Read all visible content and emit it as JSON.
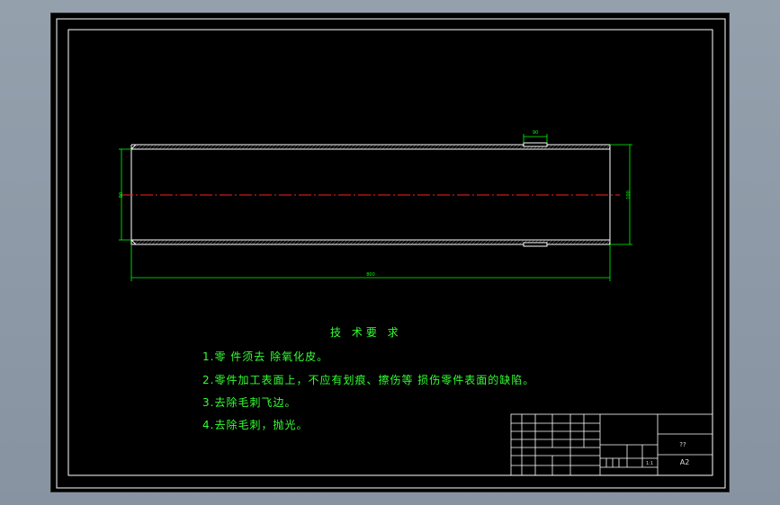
{
  "drawing": {
    "dimensions": {
      "top_width": "90",
      "left_diameter": "80",
      "right_diameter": "100",
      "length": "800"
    },
    "tech_requirements": {
      "title": "技 术要 求",
      "items": [
        "1.零 件须去 除氧化皮。",
        "2.零件加工表面上，不应有划痕、擦伤等 损伤零件表面的缺陷。",
        "3.去除毛刺飞边。",
        "4.去除毛刺，抛光。"
      ]
    },
    "title_block": {
      "part_name": "??",
      "sheet_size": "A2",
      "scale": "1:1"
    },
    "colors": {
      "background": "#000000",
      "frame": "#ffffff",
      "dimension": "#00ff00",
      "centerline": "#ff2020",
      "text": "#33ff33"
    }
  }
}
